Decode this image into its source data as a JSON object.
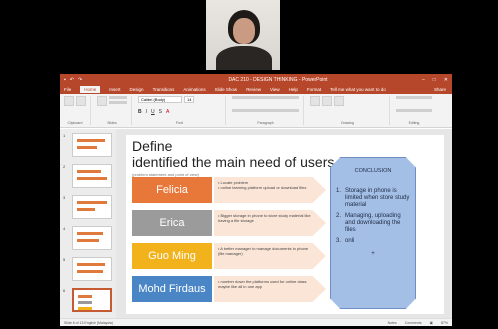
{
  "window": {
    "title": "DAC 210 - DESIGN THINKING - PowerPoint",
    "tabs": [
      "File",
      "Home",
      "Insert",
      "Design",
      "Transitions",
      "Animations",
      "Slide Show",
      "Review",
      "View",
      "Help",
      "Format"
    ],
    "tell_me": "Tell me what you want to do",
    "share": "Share"
  },
  "ribbon": {
    "groups": [
      "Clipboard",
      "Slides",
      "Font",
      "Paragraph",
      "Drawing",
      "Editing"
    ],
    "font_name": "Calibri (Body)",
    "font_size": "14"
  },
  "thumbnails": [
    "1",
    "2",
    "3",
    "4",
    "5",
    "6"
  ],
  "slide": {
    "title_line1": "Define",
    "title_line2": "identified the main need of users",
    "subtitle": "(problem statement and point of view)",
    "rows": [
      {
        "name": "Felicia",
        "color": "#e8783a",
        "text": "• Locate problem\n• online learning platform upload or download files"
      },
      {
        "name": "Erica",
        "color": "#9b9b9b",
        "text": "• Bigger storage in phone to store study material like having a file storage"
      },
      {
        "name": "Guo Ming",
        "color": "#f2b21b",
        "text": "• A better manager to manage documents in phone (file manager)"
      },
      {
        "name": "Mohd Firdaus",
        "color": "#4a86c5",
        "text": "• number down the platforms used for online class maybe like all in one app"
      }
    ],
    "conclusion": {
      "heading": "CONCLUSION",
      "items": [
        {
          "n": "1.",
          "text": "Storage in phone is limited when store study material"
        },
        {
          "n": "2.",
          "text": "Managing, uploading and downloading the files"
        },
        {
          "n": "3.",
          "text": "onli"
        }
      ],
      "plus": "+"
    }
  },
  "status": {
    "left": "Slide 6 of 13   English (Malaysia)",
    "notes": "Notes",
    "comments": "Comments",
    "zoom": "87%"
  }
}
